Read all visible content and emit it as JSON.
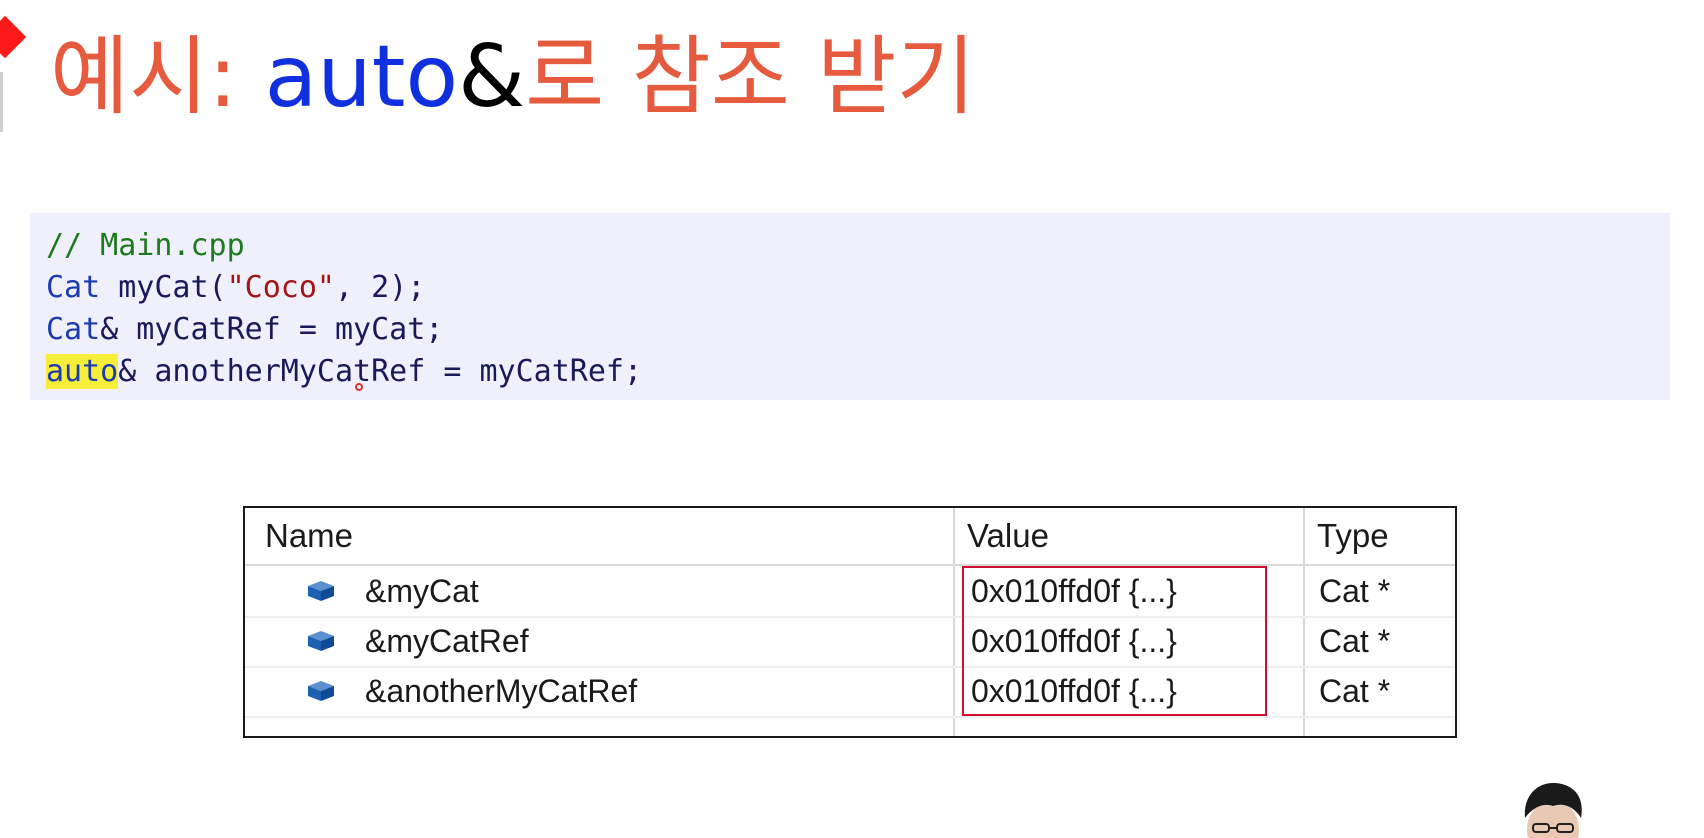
{
  "title": {
    "part1": "예시: ",
    "part2": "auto",
    "part3": "&",
    "part4": "로 참조 받기"
  },
  "code": {
    "line1": {
      "comment": "// Main.cpp"
    },
    "line2": {
      "type": "Cat",
      "rest1": " myCat(",
      "str": "\"Coco\"",
      "rest2": ", 2);"
    },
    "line3": {
      "type": "Cat",
      "rest": "& myCatRef = myCat;"
    },
    "line4": {
      "highlight": "auto",
      "amp": "&",
      "rest": " anotherMyCatRef = myCatRef;"
    }
  },
  "watch": {
    "headers": {
      "name": "Name",
      "value": "Value",
      "type": "Type"
    },
    "rows": [
      {
        "name": "&myCat",
        "value": "0x010ffd0f {...}",
        "type": "Cat *",
        "icon": "object-icon"
      },
      {
        "name": "&myCatRef",
        "value": "0x010ffd0f {...}",
        "type": "Cat *",
        "icon": "object-icon"
      },
      {
        "name": "&anotherMyCatRef",
        "value": "0x010ffd0f {...}",
        "type": "Cat *",
        "icon": "object-icon"
      }
    ]
  },
  "colors": {
    "title_korean": "#e65a3e",
    "title_auto": "#1030e0",
    "code_background": "#f0f0fc",
    "highlight": "#f7ee3a",
    "value_box_border": "#d01030"
  }
}
